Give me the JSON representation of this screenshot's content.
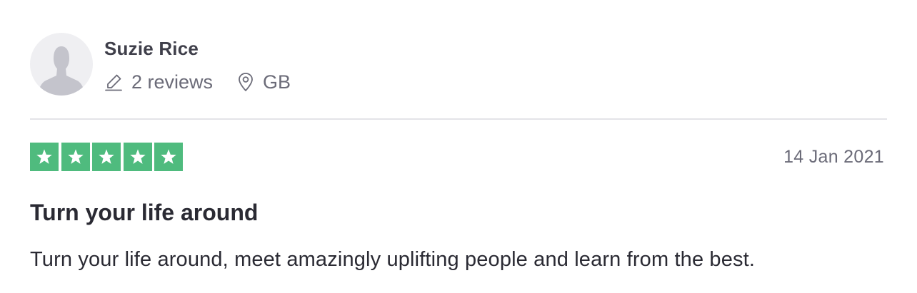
{
  "consumer": {
    "name": "Suzie Rice",
    "reviews_count": "2 reviews",
    "country": "GB"
  },
  "review": {
    "rating_stars": 5,
    "date": "14 Jan 2021",
    "title": "Turn your life around",
    "text": "Turn your life around, meet amazingly uplifting people and learn from the best."
  },
  "icons": {
    "avatar": "user-silhouette-icon",
    "reviews": "pencil-icon",
    "location": "map-pin-icon",
    "star": "star-icon"
  },
  "colors": {
    "star_background": "#4fbb7e",
    "avatar_background": "#efeff2",
    "muted_text": "#6b6b78",
    "divider": "#e3e3e8"
  }
}
